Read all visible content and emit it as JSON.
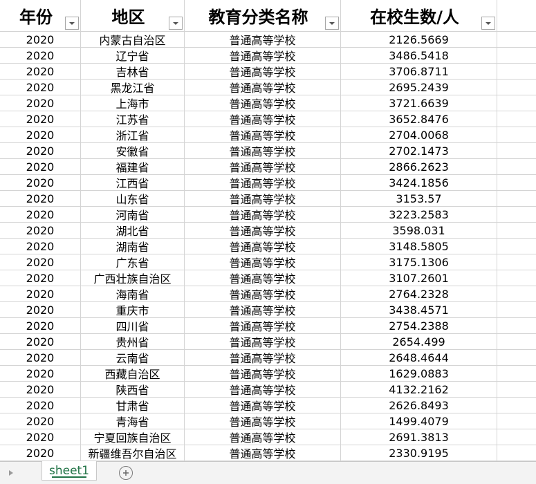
{
  "headers": [
    {
      "label": "年份"
    },
    {
      "label": "地区"
    },
    {
      "label": "教育分类名称"
    },
    {
      "label": "在校生数/人"
    }
  ],
  "rows": [
    {
      "year": "2020",
      "region": "内蒙古自治区",
      "category": "普通高等学校",
      "students": "2126.5669"
    },
    {
      "year": "2020",
      "region": "辽宁省",
      "category": "普通高等学校",
      "students": "3486.5418"
    },
    {
      "year": "2020",
      "region": "吉林省",
      "category": "普通高等学校",
      "students": "3706.8711"
    },
    {
      "year": "2020",
      "region": "黑龙江省",
      "category": "普通高等学校",
      "students": "2695.2439"
    },
    {
      "year": "2020",
      "region": "上海市",
      "category": "普通高等学校",
      "students": "3721.6639"
    },
    {
      "year": "2020",
      "region": "江苏省",
      "category": "普通高等学校",
      "students": "3652.8476"
    },
    {
      "year": "2020",
      "region": "浙江省",
      "category": "普通高等学校",
      "students": "2704.0068"
    },
    {
      "year": "2020",
      "region": "安徽省",
      "category": "普通高等学校",
      "students": "2702.1473"
    },
    {
      "year": "2020",
      "region": "福建省",
      "category": "普通高等学校",
      "students": "2866.2623"
    },
    {
      "year": "2020",
      "region": "江西省",
      "category": "普通高等学校",
      "students": "3424.1856"
    },
    {
      "year": "2020",
      "region": "山东省",
      "category": "普通高等学校",
      "students": "3153.57"
    },
    {
      "year": "2020",
      "region": "河南省",
      "category": "普通高等学校",
      "students": "3223.2583"
    },
    {
      "year": "2020",
      "region": "湖北省",
      "category": "普通高等学校",
      "students": "3598.031"
    },
    {
      "year": "2020",
      "region": "湖南省",
      "category": "普通高等学校",
      "students": "3148.5805"
    },
    {
      "year": "2020",
      "region": "广东省",
      "category": "普通高等学校",
      "students": "3175.1306"
    },
    {
      "year": "2020",
      "region": "广西壮族自治区",
      "category": "普通高等学校",
      "students": "3107.2601"
    },
    {
      "year": "2020",
      "region": "海南省",
      "category": "普通高等学校",
      "students": "2764.2328"
    },
    {
      "year": "2020",
      "region": "重庆市",
      "category": "普通高等学校",
      "students": "3438.4571"
    },
    {
      "year": "2020",
      "region": "四川省",
      "category": "普通高等学校",
      "students": "2754.2388"
    },
    {
      "year": "2020",
      "region": "贵州省",
      "category": "普通高等学校",
      "students": "2654.499"
    },
    {
      "year": "2020",
      "region": "云南省",
      "category": "普通高等学校",
      "students": "2648.4644"
    },
    {
      "year": "2020",
      "region": "西藏自治区",
      "category": "普通高等学校",
      "students": "1629.0883"
    },
    {
      "year": "2020",
      "region": "陕西省",
      "category": "普通高等学校",
      "students": "4132.2162"
    },
    {
      "year": "2020",
      "region": "甘肃省",
      "category": "普通高等学校",
      "students": "2626.8493"
    },
    {
      "year": "2020",
      "region": "青海省",
      "category": "普通高等学校",
      "students": "1499.4079"
    },
    {
      "year": "2020",
      "region": "宁夏回族自治区",
      "category": "普通高等学校",
      "students": "2691.3813"
    },
    {
      "year": "2020",
      "region": "新疆维吾尔自治区",
      "category": "普通高等学校",
      "students": "2330.9195"
    }
  ],
  "tabs": {
    "sheet_name": "sheet1",
    "prev_icon": "triangle-right-icon",
    "add_icon": "plus-circle-icon"
  },
  "icons": {
    "filter": "filter-dropdown-icon"
  },
  "colors": {
    "grid": "#d4d4d4",
    "tab_accent": "#217346",
    "tabbar_bg": "#f3f3f3"
  }
}
